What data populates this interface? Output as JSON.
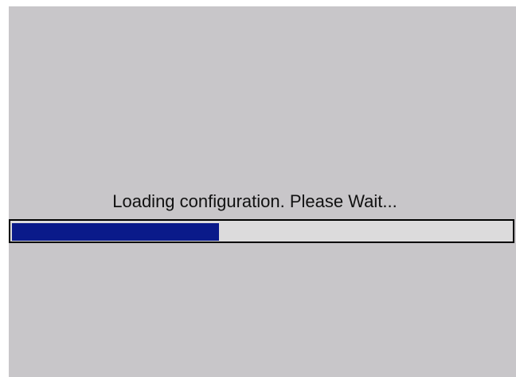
{
  "status": {
    "message": "Loading configuration. Please Wait..."
  },
  "progress": {
    "fraction": 0.415,
    "fill_color": "#0a1a8a",
    "track_color": "#dcdbdc"
  },
  "colors": {
    "background": "#c8c6c9",
    "text": "#111111"
  }
}
